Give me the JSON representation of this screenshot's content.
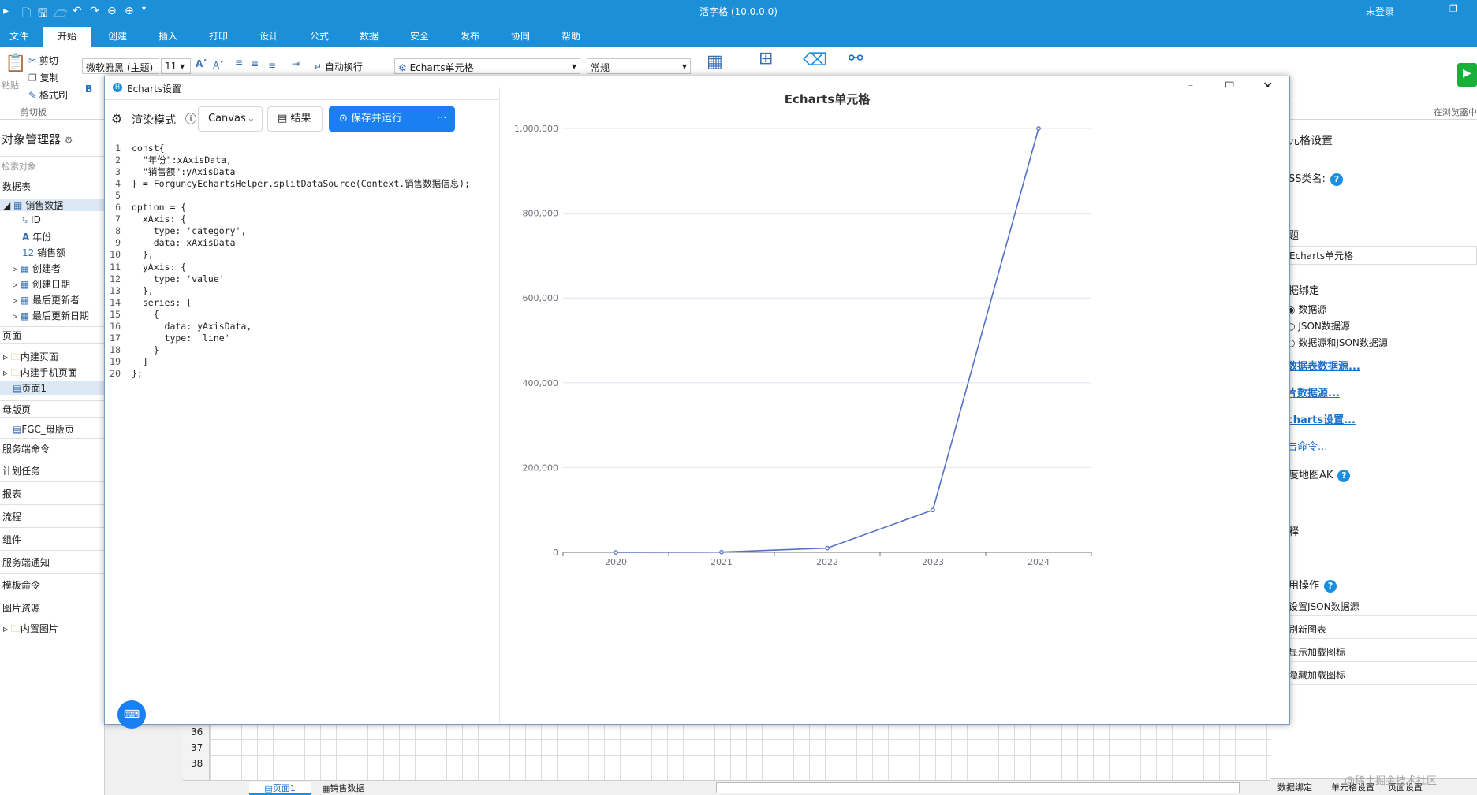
{
  "app": {
    "title": "活字格 (10.0.0.0)",
    "login": "未登录"
  },
  "menu": [
    "文件",
    "开始",
    "创建",
    "插入",
    "打印",
    "设计",
    "公式",
    "数据",
    "安全",
    "发布",
    "协同",
    "帮助"
  ],
  "ribbon": {
    "cut": "剪切",
    "copy": "复制",
    "format_painter": "格式刷",
    "paste": "粘贴",
    "clipboard": "剪切板",
    "font": "微软雅黑 (主题)",
    "font_size": "11",
    "wrap": "自动换行",
    "cell_type": "Echarts单元格",
    "number_format": "常规",
    "browser": "在浏览器中"
  },
  "left": {
    "title": "对象管理器",
    "search_placeholder": "检索对象",
    "datatable": "数据表",
    "table": "销售数据",
    "fields": [
      "ID",
      "年份",
      "销售额",
      "创建者",
      "创建日期",
      "最后更新者",
      "最后更新日期"
    ],
    "pages_section": "页面",
    "pages": [
      "内建页面",
      "内建手机页面",
      "页面1"
    ],
    "master_section": "母版页",
    "master": "FGC_母版页",
    "sections": [
      "服务端命令",
      "计划任务",
      "报表",
      "流程",
      "组件",
      "服务端通知",
      "模板命令",
      "图片资源"
    ],
    "images": "内置图片"
  },
  "right": {
    "header": "元格设置",
    "css_label": "SS类名:",
    "title_label": "题",
    "title_value": "Echarts单元格",
    "binding_label": "据绑定",
    "binding_options": [
      "数据源",
      "JSON数据源",
      "数据源和JSON数据源"
    ],
    "links": [
      "数据表数据源...",
      "片数据源...",
      "charts设置...",
      "击命令..."
    ],
    "baidu_ak": "度地图AK",
    "comment": "释",
    "ops_label": "用操作",
    "ops": [
      "设置JSON数据源",
      "刷新图表",
      "显示加载图标",
      "隐藏加载图标"
    ],
    "bottom_tabs": [
      "数据绑定",
      "单元格设置",
      "页面设置"
    ],
    "watermark": "@稀土掘金技术社区"
  },
  "grid": {
    "rows": [
      "36",
      "37",
      "38"
    ],
    "tabs": [
      "页面1",
      "销售数据"
    ]
  },
  "dialog": {
    "title": "Echarts设置",
    "render_mode": "渲染模式",
    "renderer": "Canvas",
    "result": "结果",
    "save_run": "保存并运行",
    "more": "···"
  },
  "code": [
    "const{",
    "  \"年份\":xAxisData,",
    "  \"销售额\":yAxisData",
    "} = ForguncyEchartsHelper.splitDataSource(Context.销售数据信息);",
    "",
    "option = {",
    "  xAxis: {",
    "    type: 'category',",
    "    data: xAxisData",
    "  },",
    "  yAxis: {",
    "    type: 'value'",
    "  },",
    "  series: [",
    "    {",
    "      data: yAxisData,",
    "      type: 'line'",
    "    }",
    "  ]",
    "};"
  ],
  "chart_data": {
    "type": "line",
    "title": "Echarts单元格",
    "categories": [
      "2020",
      "2021",
      "2022",
      "2023",
      "2024"
    ],
    "values": [
      0,
      500,
      10000,
      100000,
      1000000
    ],
    "ylim": [
      0,
      1000000
    ],
    "yticks": [
      "0",
      "200,000",
      "400,000",
      "600,000",
      "800,000",
      "1,000,000"
    ],
    "grid": true,
    "color": "#5470c6"
  }
}
